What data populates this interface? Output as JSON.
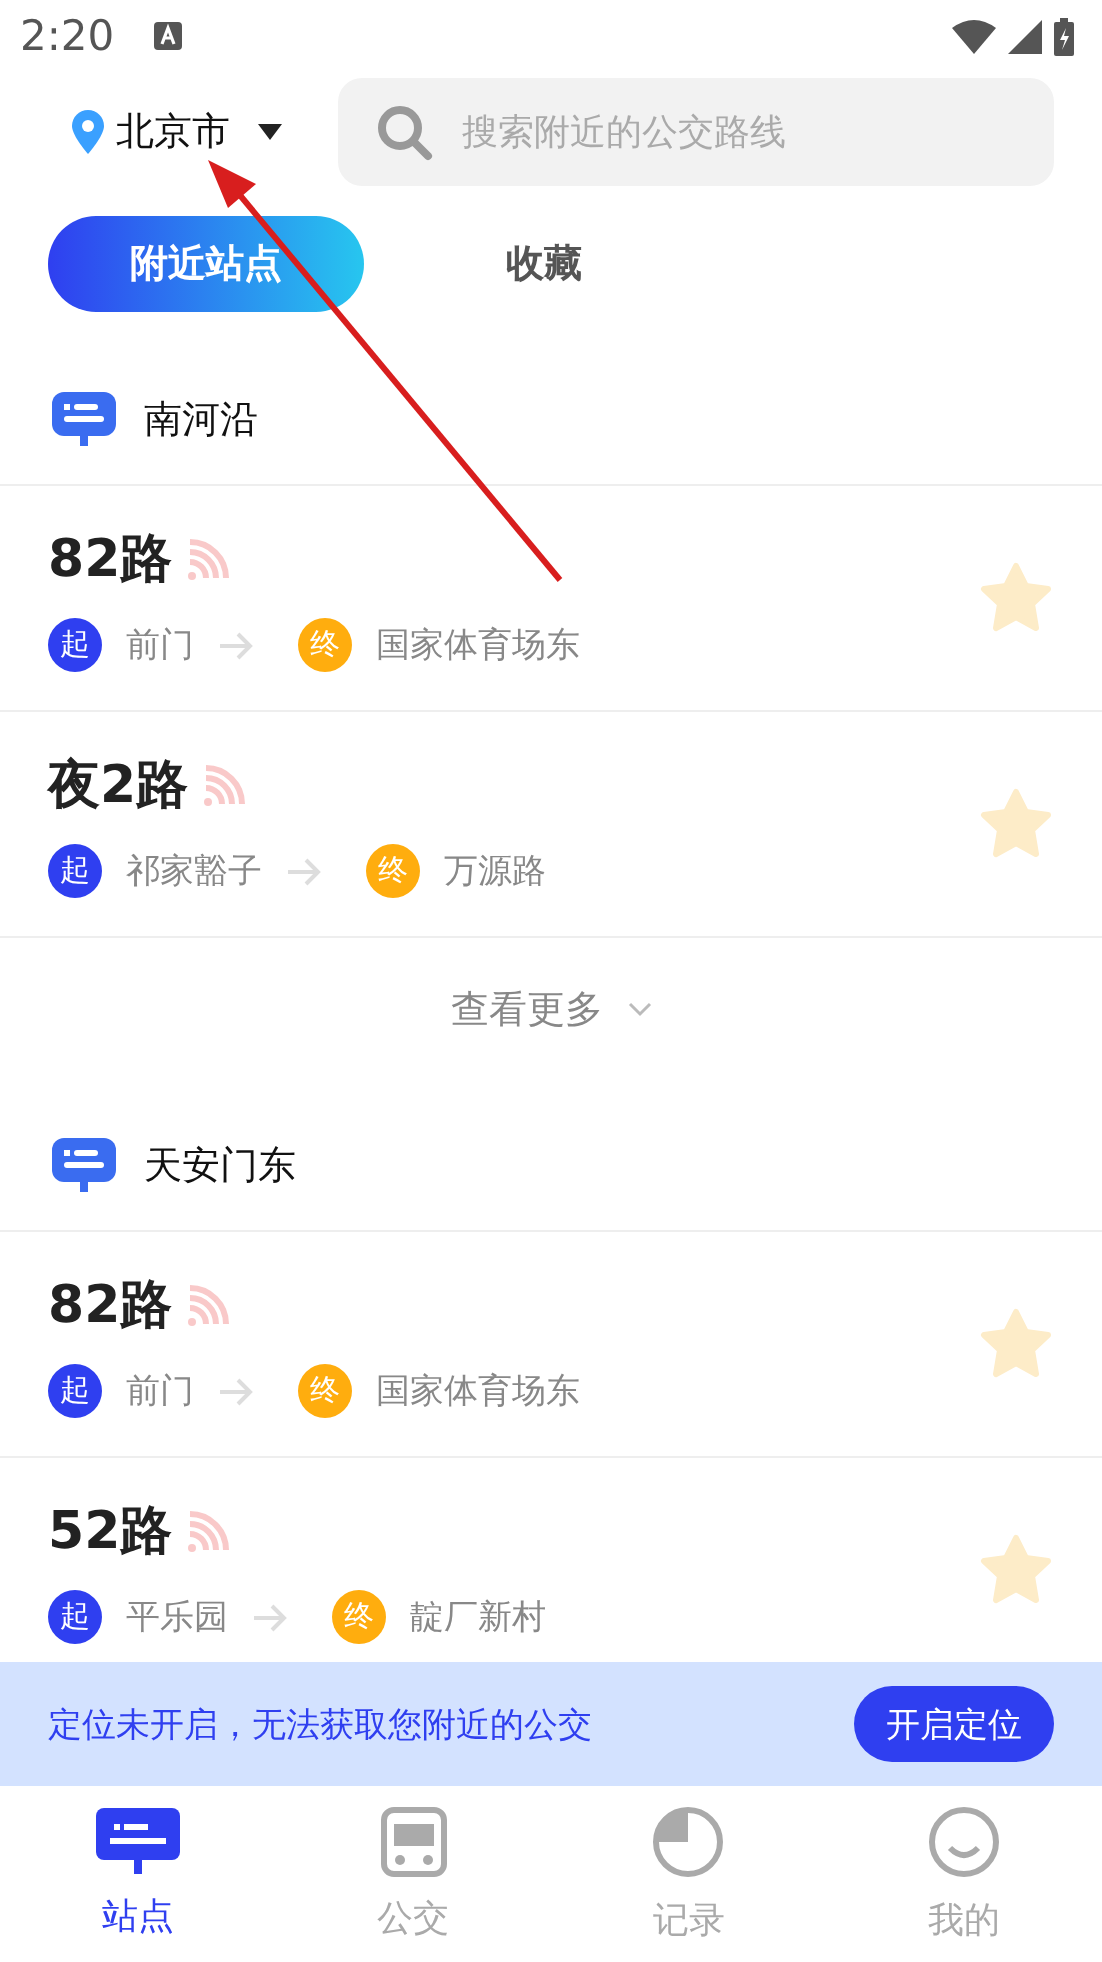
{
  "status_bar": {
    "time": "2:20"
  },
  "header": {
    "city": "北京市",
    "search": {
      "placeholder": "搜索附近的公交路线"
    }
  },
  "tabs": [
    {
      "label": "附近站点",
      "selected": true
    },
    {
      "label": "收藏",
      "selected": false
    }
  ],
  "stations": [
    {
      "name": "南河沿",
      "routes": [
        {
          "name": "82路",
          "start_badge": "起",
          "from": "前门",
          "end_badge": "终",
          "to": "国家体育场东",
          "favorited": false
        },
        {
          "name": "夜2路",
          "start_badge": "起",
          "from": "祁家豁子",
          "end_badge": "终",
          "to": "万源路",
          "favorited": false
        }
      ],
      "more": "查看更多"
    },
    {
      "name": "天安门东",
      "routes": [
        {
          "name": "82路",
          "start_badge": "起",
          "from": "前门",
          "end_badge": "终",
          "to": "国家体育场东",
          "favorited": false
        },
        {
          "name": "52路",
          "start_badge": "起",
          "from": "平乐园",
          "end_badge": "终",
          "to": "靛厂新村",
          "favorited": false
        }
      ]
    }
  ],
  "banner": {
    "text": "定位未开启，无法获取您附近的公交",
    "button": "开启定位"
  },
  "nav": [
    {
      "label": "站点",
      "kind": "station",
      "selected": true
    },
    {
      "label": "公交",
      "kind": "bus",
      "selected": false
    },
    {
      "label": "记录",
      "kind": "history",
      "selected": false
    },
    {
      "label": "我的",
      "kind": "profile",
      "selected": false
    }
  ]
}
